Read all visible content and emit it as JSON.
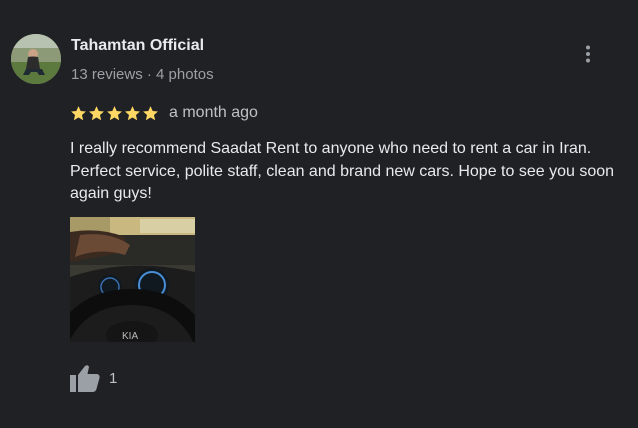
{
  "review": {
    "author": {
      "name": "Tahamtan Official",
      "meta": "13 reviews · 4 photos",
      "avatar_icon": "user-avatar"
    },
    "rating": {
      "stars": 5,
      "max_stars": 5,
      "star_color": "#fdd663"
    },
    "time_ago": "a month ago",
    "text": "I really recommend Saadat Rent to anyone who need to rent a car in Iran. Perfect service, polite staff, clean and brand new cars. Hope to see you soon again guys!",
    "photo_icon": "car-interior-photo",
    "likes": {
      "count": "1",
      "icon": "thumbs-up-icon"
    },
    "menu_icon": "more-vert-icon"
  }
}
